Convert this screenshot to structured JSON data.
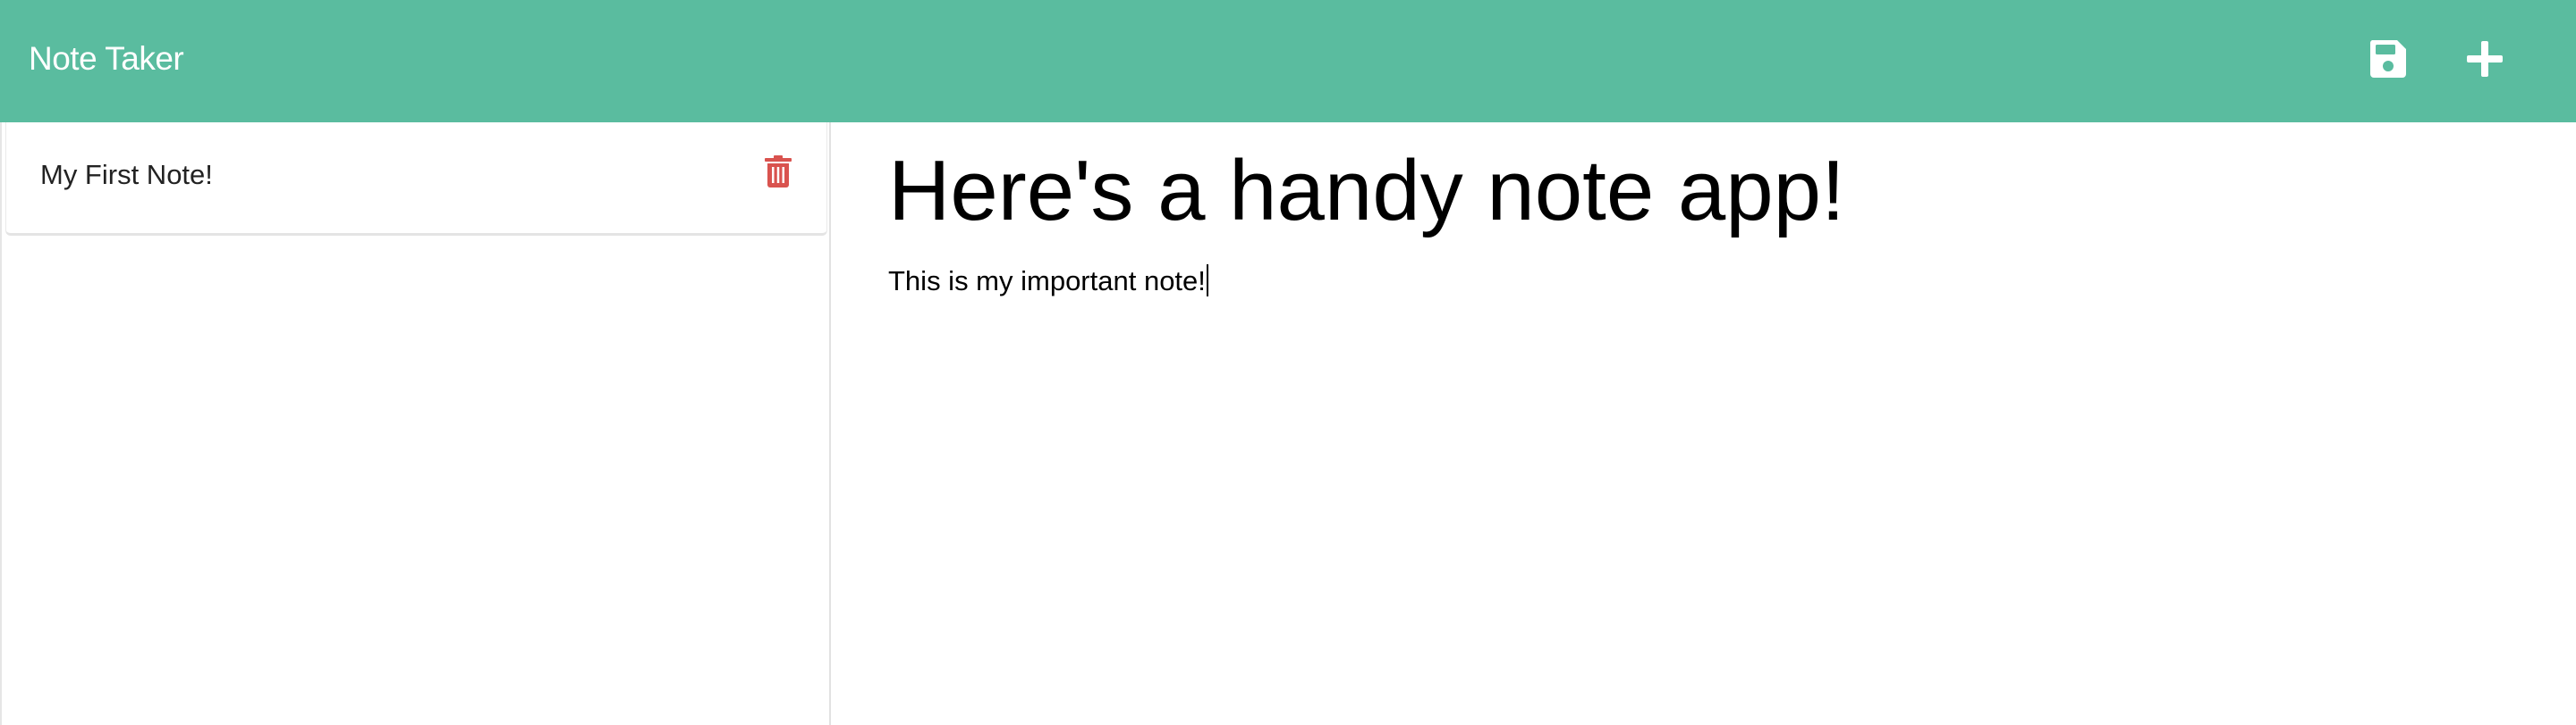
{
  "navbar": {
    "brand": "Note Taker",
    "background_color": "#5abc9f",
    "save_icon": "floppy-disk-icon",
    "add_icon": "plus-icon"
  },
  "sidebar": {
    "notes": [
      {
        "title": "My First Note!",
        "delete_icon": "trash-icon",
        "delete_color": "#d9534f"
      }
    ]
  },
  "main": {
    "note_title": "Here's a handy note app!",
    "note_text": "This is my important note!"
  }
}
